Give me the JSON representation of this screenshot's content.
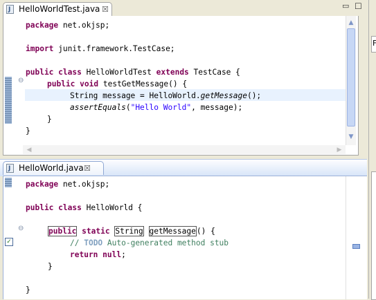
{
  "editor1": {
    "tab": {
      "label": "HelloWorldTest.java",
      "close": "☒"
    },
    "window_buttons": {
      "minimize": "▭",
      "maximize": "☐"
    },
    "lines": {
      "l1_kw": "package",
      "l1_rest": " net.okjsp;",
      "l3_kw": "import",
      "l3_rest": " junit.framework.TestCase;",
      "l5_kw1": "public",
      "l5_kw2": "class",
      "l5_mid": " HelloWorldTest ",
      "l5_kw3": "extends",
      "l5_rest": " TestCase {",
      "l6_kw1": "public",
      "l6_kw2": "void",
      "l6_rest": " testGetMessage() {",
      "l7_a": "String message = HelloWorld.",
      "l7_it": "getMessage",
      "l7_b": "();",
      "l8_it": "assertEquals",
      "l8_a": "(",
      "l8_str": "\"Hello World\"",
      "l8_b": ", message);",
      "l9": "}",
      "l10": "}"
    }
  },
  "editor2": {
    "tab": {
      "label": "HelloWorld.java",
      "close": "☒"
    },
    "lines": {
      "l1_kw": "package",
      "l1_rest": " net.okjsp;",
      "l3_kw1": "public",
      "l3_kw2": "class",
      "l3_rest": " HelloWorld {",
      "l5_kw1": "public",
      "l5_kw2": "static",
      "l5_type": "String",
      "l5_name": "getMessage",
      "l5_rest": "() {",
      "l6_cmt": "// ",
      "l6_todo": "TODO",
      "l6_cmt2": " Auto-generated method stub",
      "l7_kw1": "return",
      "l7_kw2": "null",
      "l7_rest": ";",
      "l8": "}",
      "l10": "}"
    }
  },
  "side_panel": {
    "label": "F"
  },
  "icons": {
    "collapse": "⊖",
    "scroll_up": "▲",
    "scroll_down": "▼",
    "scroll_left": "◀",
    "scroll_right": "▶",
    "task": "✓"
  },
  "colors": {
    "keyword": "#7f0055",
    "string": "#2a00ff",
    "comment": "#3f7f5f",
    "todo": "#7f9fbf",
    "current_line": "#e8f2fe"
  }
}
